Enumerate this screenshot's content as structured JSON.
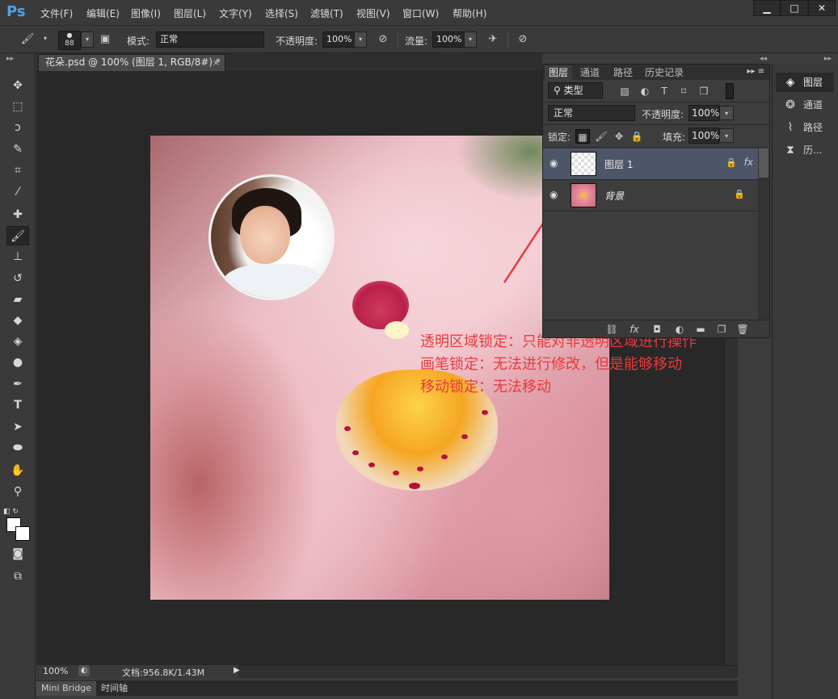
{
  "app": {
    "logo": "Ps"
  },
  "menu": [
    "文件(F)",
    "编辑(E)",
    "图像(I)",
    "图层(L)",
    "文字(Y)",
    "选择(S)",
    "滤镜(T)",
    "视图(V)",
    "窗口(W)",
    "帮助(H)"
  ],
  "window_controls": {
    "minimize": "▁",
    "maximize": "□",
    "close": "✕"
  },
  "options": {
    "brush_size": "88",
    "mode_label": "模式:",
    "mode_value": "正常",
    "opacity_label": "不透明度:",
    "opacity_value": "100%",
    "flow_label": "流量:",
    "flow_value": "100%"
  },
  "document": {
    "tab_title": "花朵.psd @ 100% (图层 1, RGB/8#) *",
    "close": "×",
    "zoom": "100%",
    "doc_size": "文档:956.8K/1.43M",
    "status_arrow": "▶"
  },
  "annotation": [
    "透明区域锁定：只能对非透明区域进行操作",
    "画笔锁定：无法进行修改，但是能够移动",
    "移动锁定：无法移动"
  ],
  "bottom_tabs": [
    "Mini Bridge",
    "时间轴"
  ],
  "layers_panel": {
    "tabs": [
      "图层",
      "通道",
      "路径",
      "历史记录"
    ],
    "filter_label": "类型",
    "blend_mode": "正常",
    "opacity_label": "不透明度:",
    "opacity_value": "100%",
    "lock_label": "锁定:",
    "fill_label": "填充:",
    "fill_value": "100%",
    "layers": [
      {
        "name": "图层 1",
        "fx": "fx",
        "selected": true
      },
      {
        "name": "背景",
        "fx": "",
        "selected": false
      }
    ]
  },
  "dock": [
    "图层",
    "通道",
    "路径",
    "历..."
  ],
  "colors": {
    "accent": "#4fa3e8",
    "annotation": "#e83a3a",
    "selected_layer": "#4d5568"
  }
}
